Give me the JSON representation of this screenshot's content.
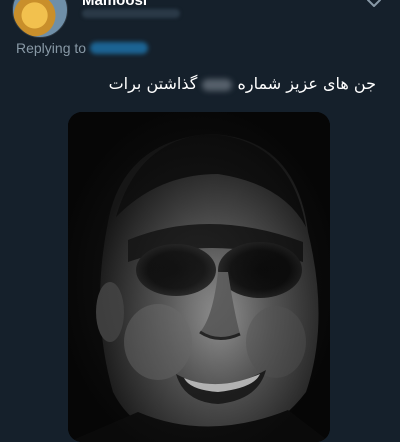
{
  "author": {
    "display_name": "Mamoosi",
    "handle_redacted": true,
    "avatar": "avatar-image"
  },
  "menu": {
    "icon": "chevron-down-icon"
  },
  "reply": {
    "label": "Replying to",
    "handle_redacted": true
  },
  "tweet": {
    "text_start": "جن های عزیز شماره",
    "text_end": "گذاشتن برات"
  },
  "media": {
    "alt": "image",
    "kind": "meme-face"
  },
  "colors": {
    "background": "#15202b",
    "secondary_text": "#8899a6",
    "link": "#1d9bf0",
    "text": "#ffffff"
  }
}
